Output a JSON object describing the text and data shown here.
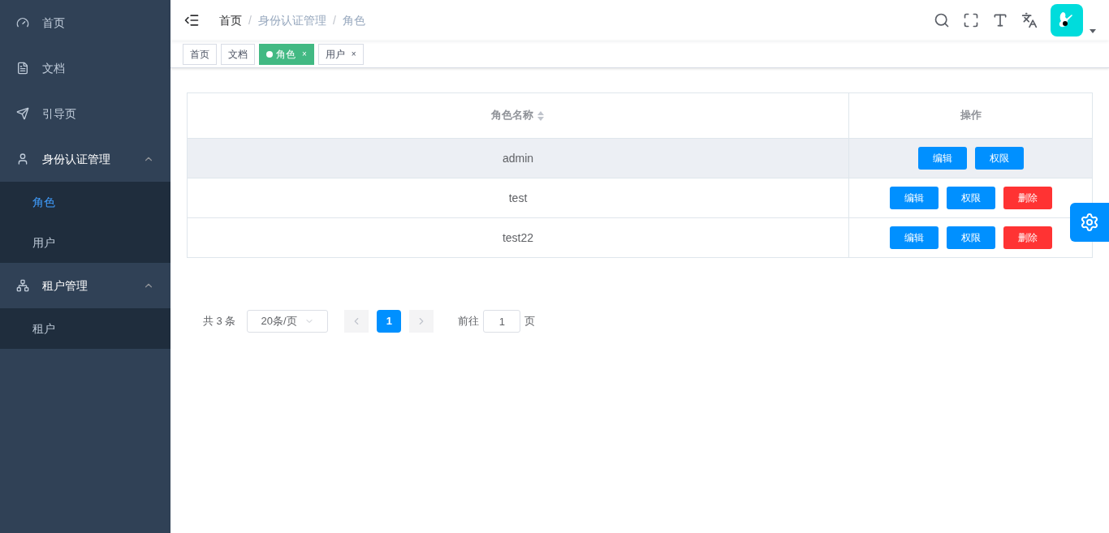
{
  "sidebar": {
    "items": [
      {
        "label": "首页"
      },
      {
        "label": "文档"
      },
      {
        "label": "引导页"
      },
      {
        "label": "身份认证管理",
        "expanded": true,
        "children": [
          {
            "label": "角色",
            "selected": true
          },
          {
            "label": "用户",
            "selected": false
          }
        ]
      },
      {
        "label": "租户管理",
        "expanded": true,
        "children": [
          {
            "label": "租户",
            "selected": false
          }
        ]
      }
    ]
  },
  "breadcrumb": [
    {
      "label": "首页",
      "link": true
    },
    {
      "separator": "/",
      "label": "身份认证管理",
      "link": false
    },
    {
      "separator": "/",
      "label": "角色",
      "link": false
    }
  ],
  "tags": [
    {
      "label": "首页",
      "selected": false
    },
    {
      "label": "文档",
      "selected": false
    },
    {
      "label": "角色",
      "selected": true,
      "close": "×"
    },
    {
      "label": "用户",
      "selected": false,
      "close": "×"
    }
  ],
  "table": {
    "columns": [
      {
        "label": "角色名称",
        "sortable": true
      },
      {
        "label": "操作",
        "sortable": false
      }
    ],
    "rows": [
      {
        "name": "admin",
        "selected": true,
        "actions": [
          {
            "label": "编辑",
            "kind": "primary"
          },
          {
            "label": "权限",
            "kind": "primary"
          }
        ]
      },
      {
        "name": "test",
        "selected": false,
        "actions": [
          {
            "label": "编辑",
            "kind": "primary"
          },
          {
            "label": "权限",
            "kind": "primary"
          },
          {
            "label": "删除",
            "kind": "danger"
          }
        ]
      },
      {
        "name": "test22",
        "selected": false,
        "actions": [
          {
            "label": "编辑",
            "kind": "primary"
          },
          {
            "label": "权限",
            "kind": "primary"
          },
          {
            "label": "删除",
            "kind": "danger"
          }
        ]
      }
    ]
  },
  "pagination": {
    "total": "共 3 条",
    "page_size": "20条/页",
    "pages": [
      {
        "label": "1",
        "selected": true
      }
    ],
    "goto_label": "前往",
    "goto_value": "1",
    "goto_suffix": "页"
  }
}
